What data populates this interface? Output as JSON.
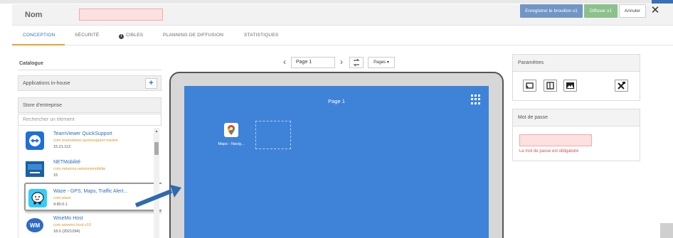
{
  "header": {
    "nom_label": "Nom",
    "save_draft": "Enregistrer le brouillon v1",
    "publish": "Diffuser v1",
    "cancel": "Annuler",
    "close_glyph": "✕"
  },
  "tabs": [
    {
      "label": "CONCEPTION"
    },
    {
      "label": "SÉCURITÉ"
    },
    {
      "label": "CIBLES"
    },
    {
      "label": "PLANNING DE DIFFUSION"
    },
    {
      "label": "STATISTIQUES"
    }
  ],
  "catalog": {
    "title": "Catalogue",
    "inhouse": "Applications in-house",
    "plus": "+",
    "store": "Store d'entreprise",
    "search_placeholder": "Rechercher un élément",
    "apps": [
      {
        "name": "TeamViewer QuickSupport",
        "pkg": "com.teamviewer.quicksupport.market",
        "ver": "15.21.113"
      },
      {
        "name": "NETMobilité",
        "pkg": "com.netsoins.netsoinsmobilite",
        "ver": "15"
      },
      {
        "name": "Waze - GPS, Maps, Traffic Alert...",
        "pkg": "com.waze",
        "ver": "4.80.0.1"
      },
      {
        "name": "WiseMo Host",
        "pkg": "com.wisemo.host.v10",
        "ver": "18.0 (2021294)"
      }
    ]
  },
  "pager": {
    "prev": "‹",
    "next": "›",
    "page_value": "Page 1",
    "pages_btn": "Pages ▾"
  },
  "device": {
    "page_title": "Page 1",
    "app_label": "Maps - Navig..."
  },
  "settings": {
    "title": "Paramètres"
  },
  "password": {
    "title": "Mot de passe",
    "error": "Le mot de passe est obligatoire"
  },
  "colors": {
    "accent": "#2b6fc0",
    "screen": "#3f83d8",
    "save": "#7195c4",
    "publish": "#8cc08c",
    "error": "#e04848",
    "tab_underline": "#f0a030"
  }
}
